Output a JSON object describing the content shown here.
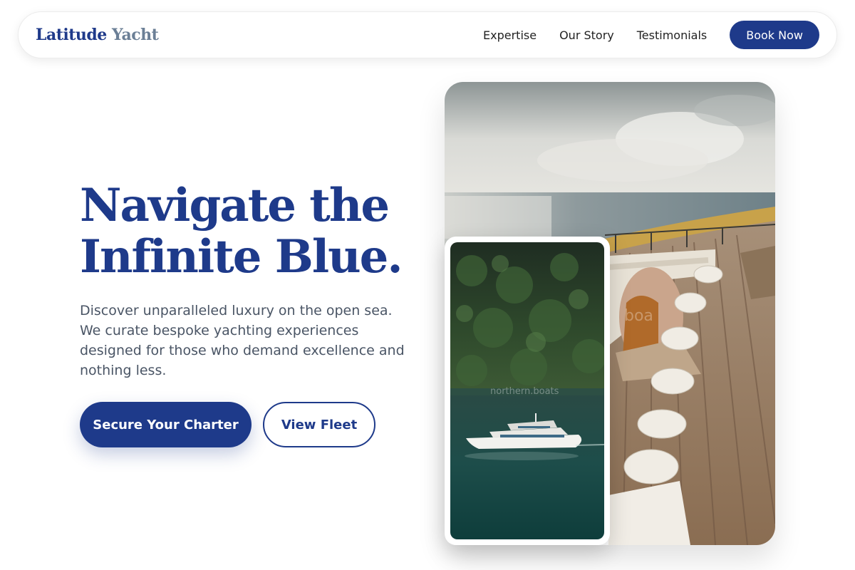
{
  "nav": {
    "logo_part1": "Latitude",
    "logo_part2": "Yacht",
    "links": [
      "Expertise",
      "Our Story",
      "Testimonials"
    ],
    "book_label": "Book Now"
  },
  "hero": {
    "title_line1": "Navigate the",
    "title_line2": "Infinite Blue.",
    "description": "Discover unparalleled luxury on the open sea. We curate bespoke yachting experiences designed for those who demand excellence and nothing less.",
    "cta_primary": "Secure Your Charter",
    "cta_secondary": "View Fleet"
  },
  "images": {
    "main_watermark": "boa",
    "inset_watermark": "northern.boats"
  },
  "colors": {
    "brand": "#1e3a8a",
    "logo_secondary": "#6b7f96",
    "text_muted": "#4a5565"
  }
}
